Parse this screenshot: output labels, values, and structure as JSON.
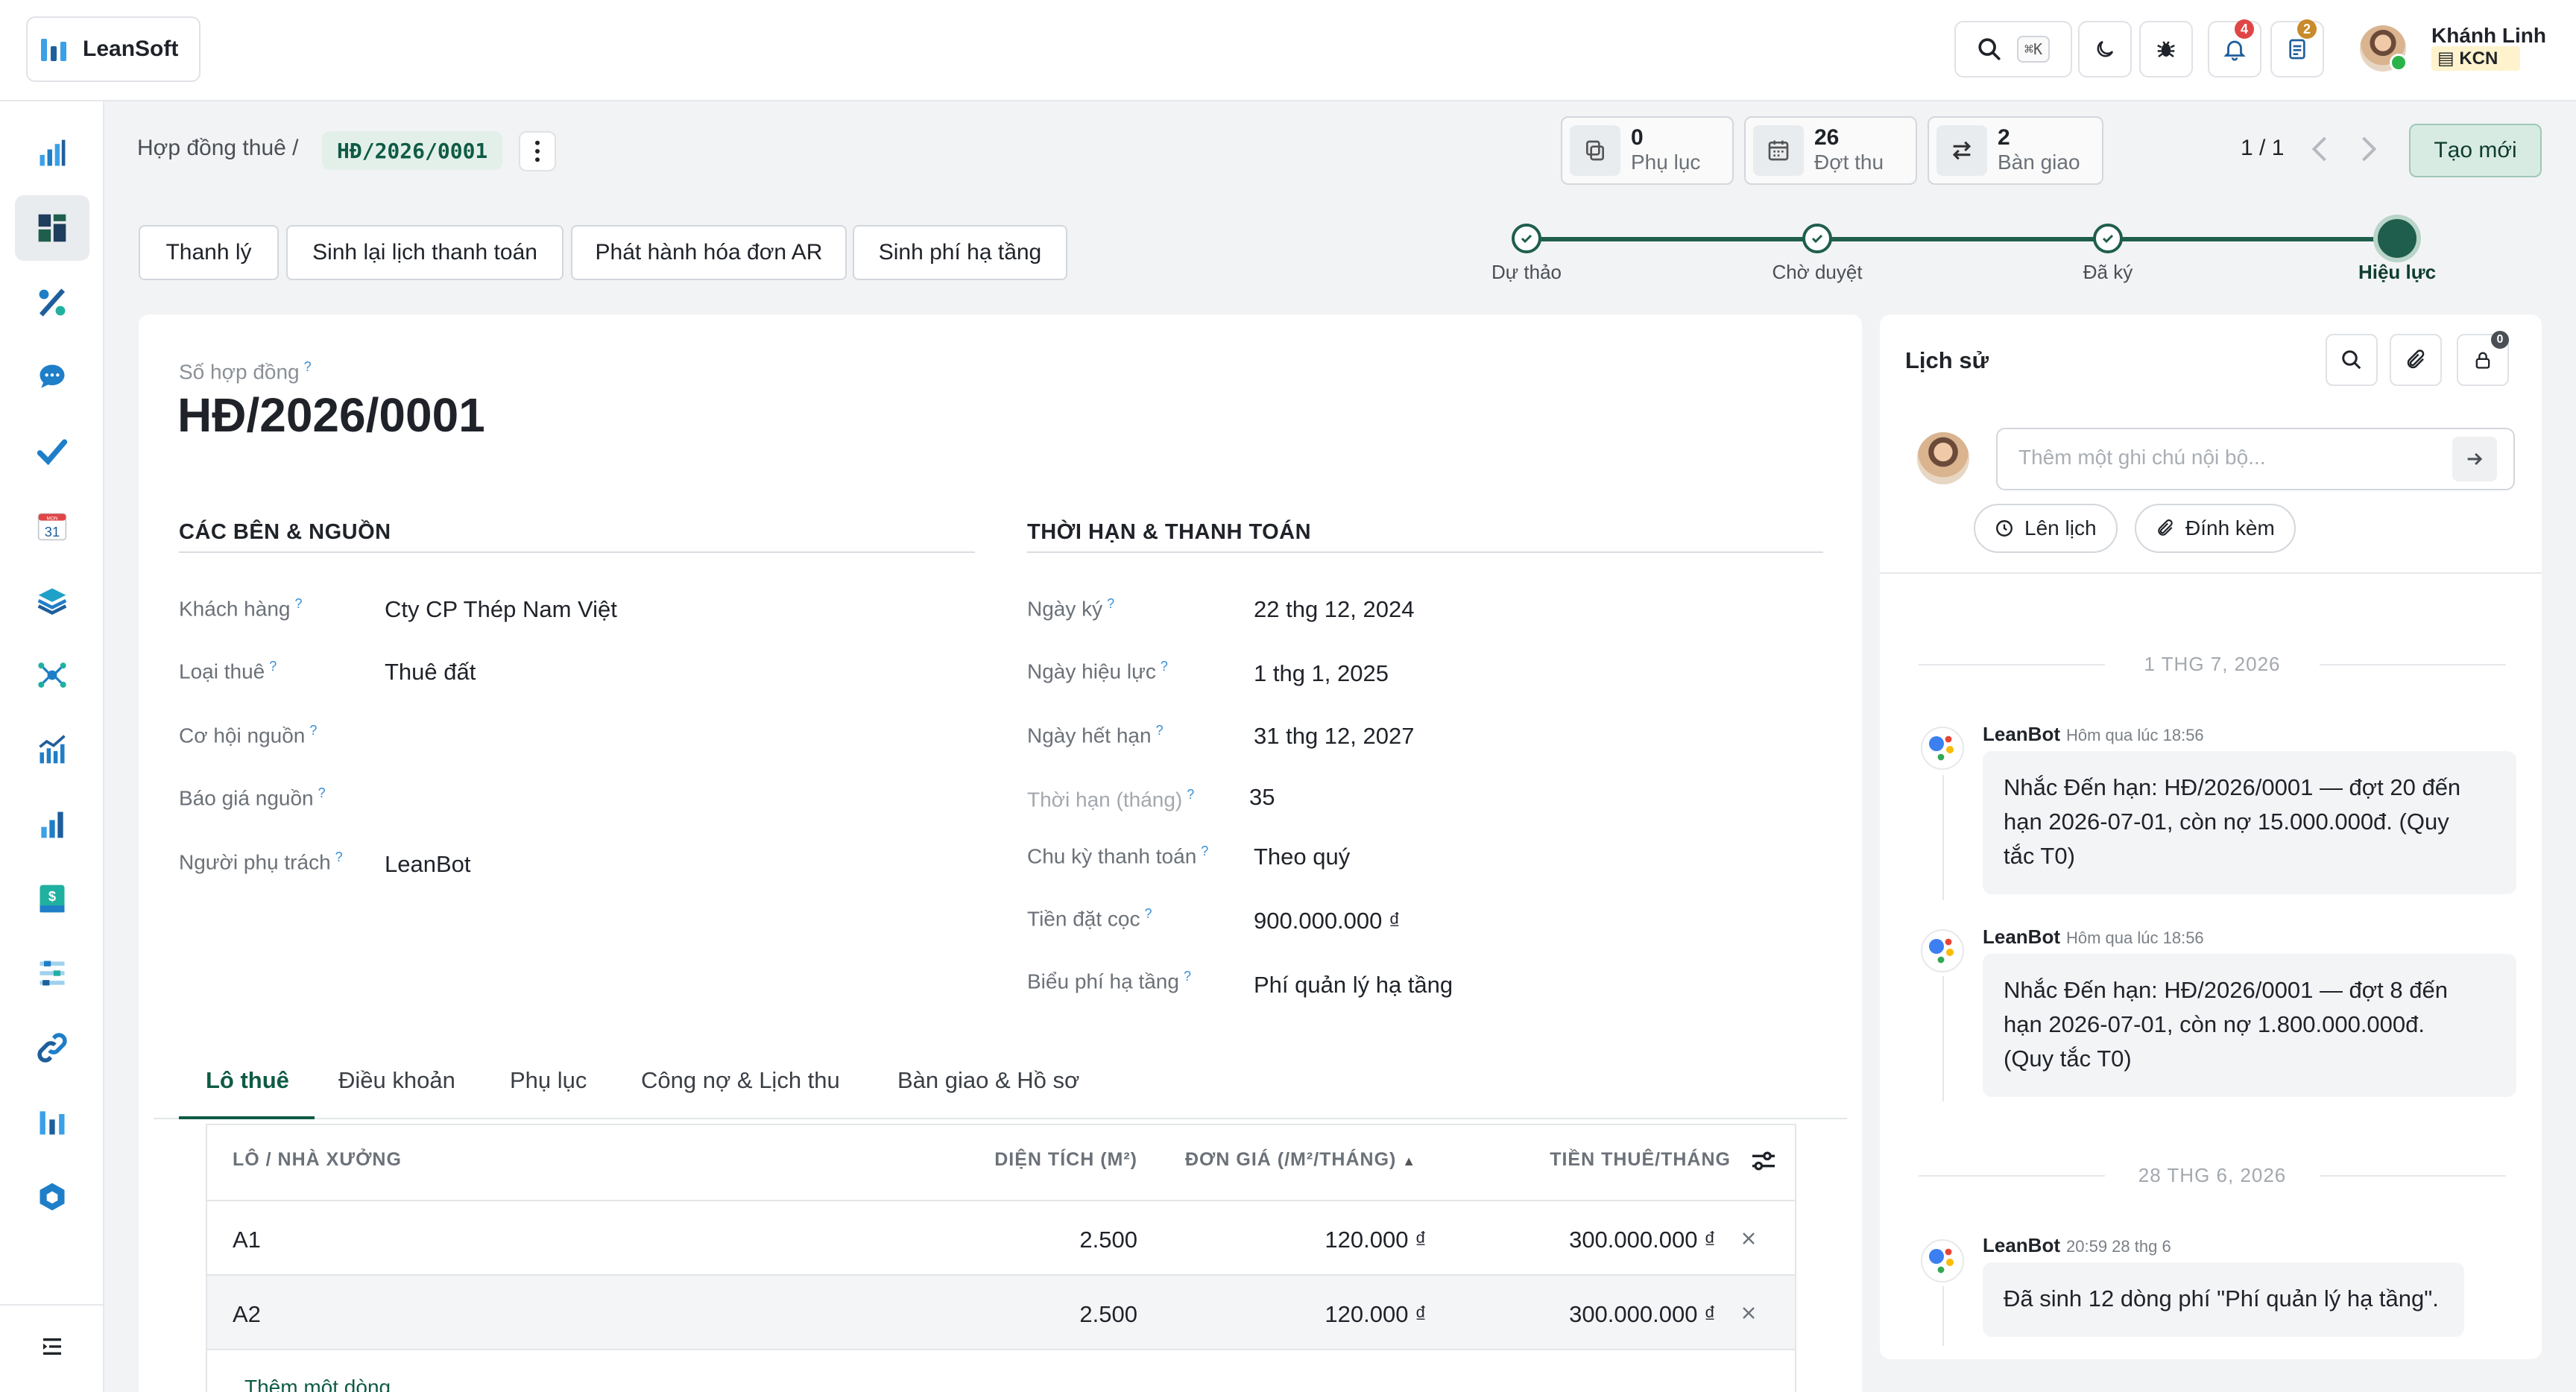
{
  "app": {
    "brand": "LeanSoft",
    "accent": "#1f5e4c"
  },
  "topbar": {
    "search_shortcut": "⌘K",
    "notifications_count": "4",
    "tasks_count": "2",
    "user_name": "Khánh Linh",
    "user_company": "KCN"
  },
  "sidebar": {
    "icons": [
      "chart-bars-icon",
      "dashboard-icon",
      "percent-icon",
      "chat-icon",
      "check-icon",
      "calendar-icon",
      "layers-icon",
      "network-icon",
      "trend-chart-icon",
      "bar-chart-icon",
      "invoice-icon",
      "settings-sliders-icon",
      "link-icon",
      "logo-bars-icon",
      "hexagon-icon",
      "collapse-menu-icon"
    ],
    "calendar_day": "31",
    "calendar_month": "MON"
  },
  "breadcrumb": {
    "parent": "Hợp đồng thuê /",
    "current": "HĐ/2026/0001"
  },
  "smart_buttons": [
    {
      "count": "0",
      "label": "Phụ lục"
    },
    {
      "count": "26",
      "label": "Đợt thu"
    },
    {
      "count": "2",
      "label": "Bàn giao"
    }
  ],
  "pager": "1 / 1",
  "create_label": "Tạo mới",
  "actions": [
    "Thanh lý",
    "Sinh lại lịch thanh toán",
    "Phát hành hóa đơn AR",
    "Sinh phí hạ tầng"
  ],
  "statusbar": {
    "steps": [
      "Dự thảo",
      "Chờ duyệt",
      "Đã ký",
      "Hiệu lực"
    ],
    "current": "Hiệu lực"
  },
  "form": {
    "number_label": "Số hợp đồng",
    "number": "HĐ/2026/0001",
    "help": "?",
    "left_section": "CÁC BÊN & NGUỒN",
    "right_section": "THỜI HẠN & THANH TOÁN",
    "left_fields": [
      {
        "label": "Khách hàng",
        "value": "Cty CP Thép Nam Việt"
      },
      {
        "label": "Loại thuê",
        "value": "Thuê đất"
      },
      {
        "label": "Cơ hội nguồn",
        "value": ""
      },
      {
        "label": "Báo giá nguồn",
        "value": ""
      },
      {
        "label": "Người phụ trách",
        "value": "LeanBot"
      }
    ],
    "right_fields": [
      {
        "label": "Ngày ký",
        "value": "22 thg 12, 2024"
      },
      {
        "label": "Ngày hiệu lực",
        "value": "1 thg 1, 2025"
      },
      {
        "label": "Ngày hết hạn",
        "value": "31 thg 12, 2027"
      },
      {
        "label": "Thời hạn (tháng)",
        "value": "35"
      },
      {
        "label": "Chu kỳ thanh toán",
        "value": "Theo quý"
      },
      {
        "label": "Tiền đặt cọc",
        "value": "900.000.000 ₫"
      },
      {
        "label": "Biểu phí hạ tầng",
        "value": "Phí quản lý hạ tầng"
      }
    ]
  },
  "tabs": [
    "Lô thuê",
    "Điều khoản",
    "Phụ lục",
    "Công nợ & Lịch thu",
    "Bàn giao & Hồ sơ"
  ],
  "table": {
    "headers": [
      "LÔ / NHÀ XƯỞNG",
      "DIỆN TÍCH (M²)",
      "ĐƠN GIÁ (/M²/THÁNG)",
      "TIỀN THUÊ/THÁNG"
    ],
    "sort_indicator": "▲",
    "rows": [
      {
        "lot": "A1",
        "area": "2.500",
        "price": "120.000 ₫",
        "rent": "300.000.000 ₫"
      },
      {
        "lot": "A2",
        "area": "2.500",
        "price": "120.000 ₫",
        "rent": "300.000.000 ₫"
      }
    ],
    "add_line": "Thêm một dòng"
  },
  "chatter": {
    "title": "Lịch sử",
    "followers_count": "0",
    "note_placeholder": "Thêm một ghi chú nội bộ...",
    "schedule_label": "Lên lịch",
    "attach_label": "Đính kèm",
    "messages": [
      {
        "date_sep": "1 THG 7, 2026",
        "author": "LeanBot",
        "time": "Hôm qua lúc 18:56",
        "lines": [
          "Nhắc Đến hạn: HĐ/2026/0001 — đợt 20 đến",
          "hạn 2026-07-01, còn nợ 15.000.000đ. (Quy",
          "tắc T0)"
        ]
      },
      {
        "date_sep": "",
        "author": "LeanBot",
        "time": "Hôm qua lúc 18:56",
        "lines": [
          "Nhắc Đến hạn: HĐ/2026/0001 — đợt 8 đến",
          "hạn 2026-07-01, còn nợ 1.800.000.000đ.",
          "(Quy tắc T0)"
        ]
      },
      {
        "date_sep": "28 THG 6, 2026",
        "author": "LeanBot",
        "time": "20:59 28 thg 6",
        "lines": [
          "Đã sinh 12 dòng phí \"Phí quản lý hạ tầng\"."
        ]
      }
    ]
  }
}
